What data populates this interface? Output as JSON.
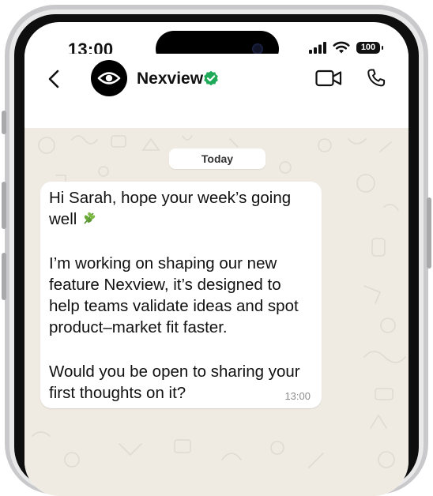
{
  "status_bar": {
    "time": "13:00",
    "battery": "100"
  },
  "header": {
    "contact_name": "Nexview"
  },
  "chat": {
    "date_label": "Today",
    "message": {
      "lines": [
        "Hi Sarah, hope your week’s going",
        "well",
        "I’m working on shaping our new",
        "feature Nexview, it’s designed to",
        "help teams validate ideas and spot",
        "product–market fit faster.",
        "Would you be open to sharing your",
        "first thoughts on it?"
      ],
      "time": "13:00"
    }
  },
  "colors": {
    "verified": "#1faa59",
    "chat_background": "#efeae2",
    "bubble": "#ffffff"
  }
}
